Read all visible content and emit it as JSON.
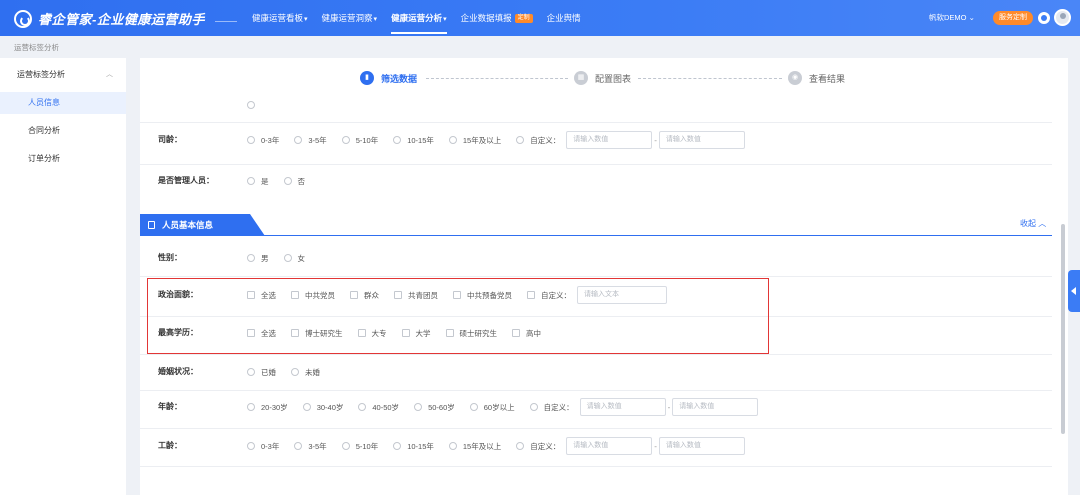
{
  "app": {
    "title": "睿企管家-企业健康运营助手",
    "nav": [
      {
        "label": "健康运营看板",
        "dropdown": true,
        "active": false
      },
      {
        "label": "健康运营洞察",
        "dropdown": true,
        "active": false
      },
      {
        "label": "健康运营分析",
        "dropdown": true,
        "active": true
      },
      {
        "label": "企业数据填报",
        "dropdown": false,
        "active": false,
        "badge": "定制"
      },
      {
        "label": "企业舆情",
        "dropdown": false,
        "active": false
      }
    ],
    "user": "帆软DEMO",
    "service_button": "服务定制",
    "accent": "#2f6ff0"
  },
  "breadcrumb": "运营标签分析",
  "sidebar": {
    "group": "运营标签分析",
    "items": [
      {
        "label": "人员信息",
        "active": true
      },
      {
        "label": "合同分析",
        "active": false
      },
      {
        "label": "订单分析",
        "active": false
      }
    ]
  },
  "steps": [
    {
      "label": "筛选数据",
      "active": true
    },
    {
      "label": "配置图表",
      "active": false
    },
    {
      "label": "查看结果",
      "active": false
    }
  ],
  "form": {
    "seniority": {
      "label": "司龄：",
      "options": [
        "0-3年",
        "3-5年",
        "5-10年",
        "10-15年",
        "15年及以上"
      ],
      "custom": "自定义：",
      "ph_min": "请输入数值",
      "ph_max": "请输入数值"
    },
    "manager": {
      "label": "是否管理人员：",
      "options": [
        "是",
        "否"
      ]
    },
    "section": {
      "title": "人员基本信息",
      "collapse": "收起"
    },
    "gender": {
      "label": "性别：",
      "options": [
        "男",
        "女"
      ]
    },
    "political": {
      "label": "政治面貌：",
      "options": [
        "全选",
        "中共党员",
        "群众",
        "共青团员",
        "中共预备党员"
      ],
      "custom": "自定义：",
      "placeholder": "请输入文本"
    },
    "education": {
      "label": "最高学历：",
      "options": [
        "全选",
        "博士研究生",
        "大专",
        "大学",
        "硕士研究生",
        "高中"
      ]
    },
    "marital": {
      "label": "婚姻状况：",
      "options": [
        "已婚",
        "未婚"
      ]
    },
    "age": {
      "label": "年龄：",
      "options": [
        "20-30岁",
        "30-40岁",
        "40-50岁",
        "50-60岁",
        "60岁以上"
      ],
      "custom": "自定义：",
      "ph_min": "请输入数值",
      "ph_max": "请输入数值"
    },
    "work_years": {
      "label": "工龄：",
      "options": [
        "0-3年",
        "3-5年",
        "5-10年",
        "10-15年",
        "15年及以上"
      ],
      "custom": "自定义：",
      "ph_min": "请输入数值",
      "ph_max": "请输入数值"
    }
  }
}
